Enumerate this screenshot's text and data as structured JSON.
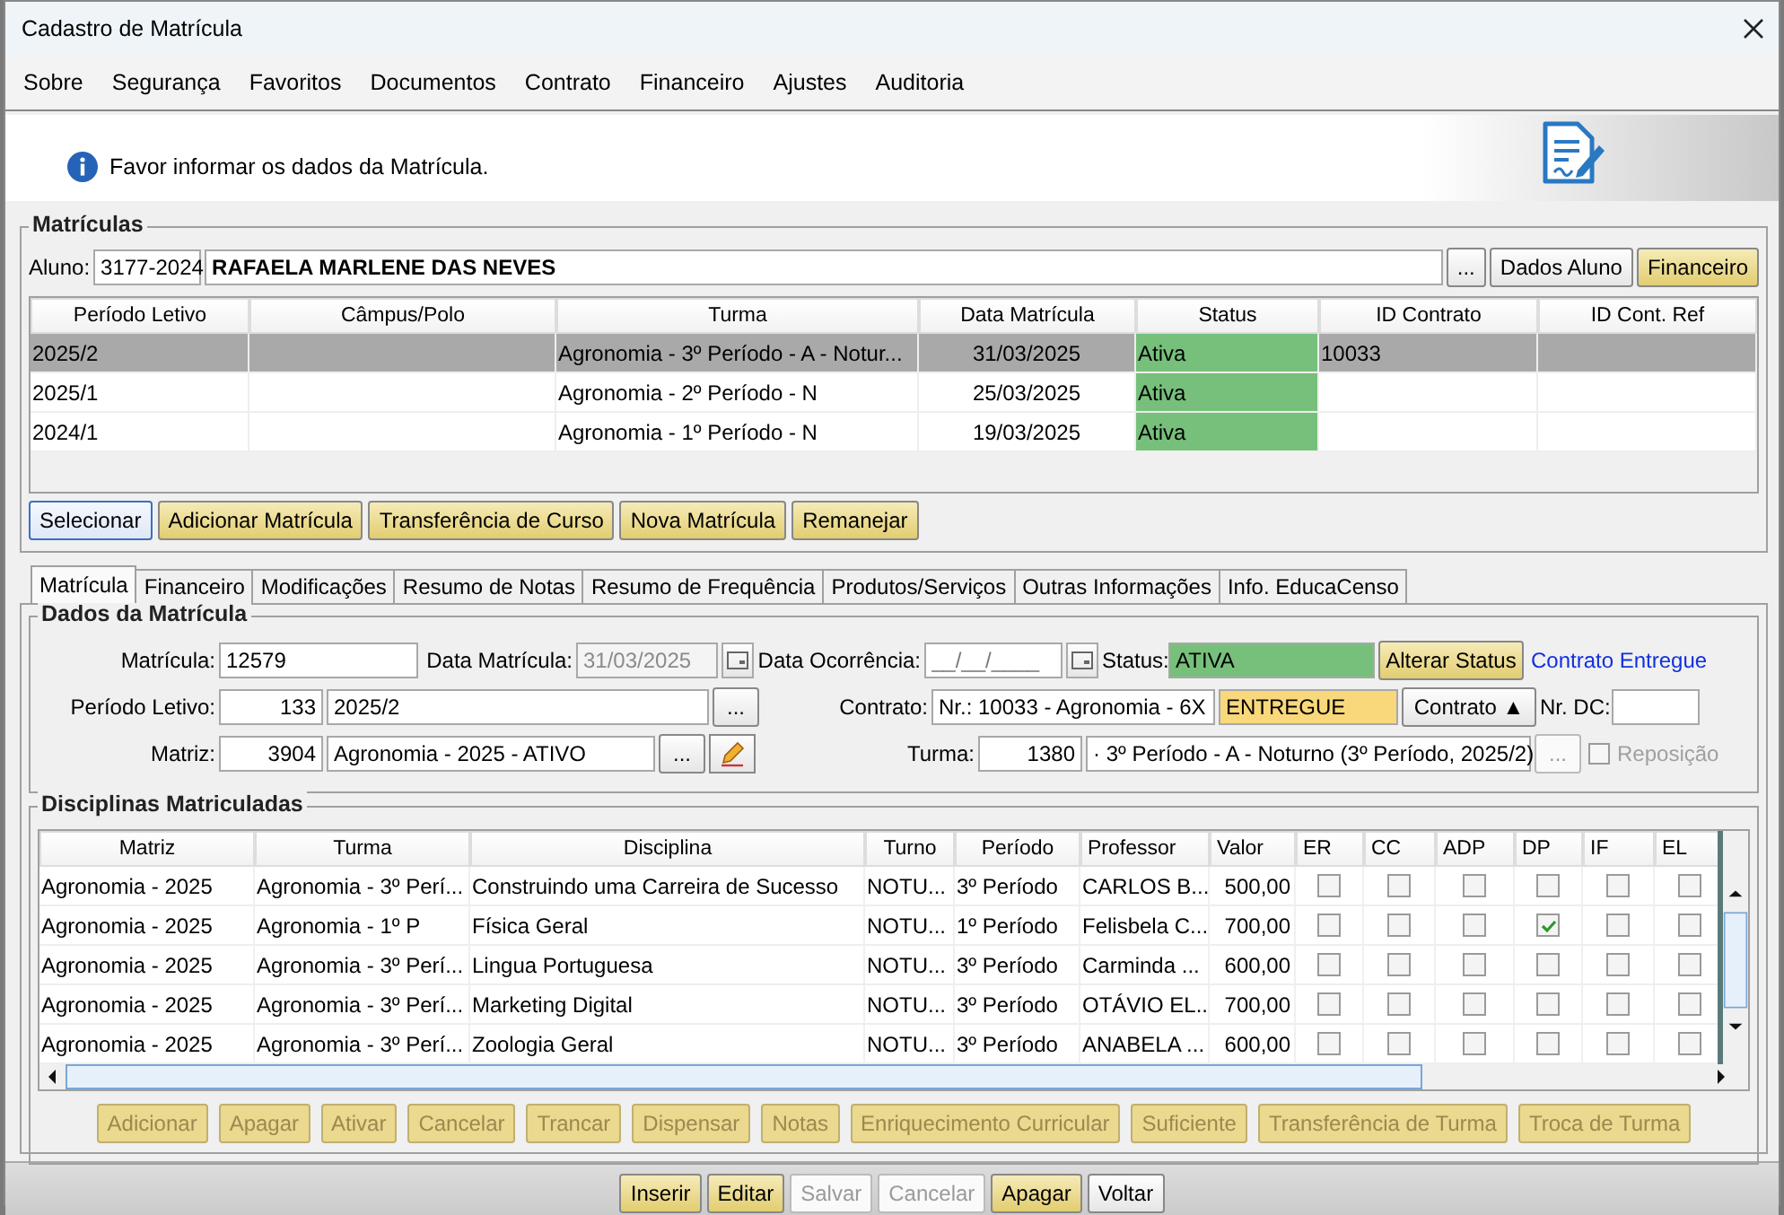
{
  "window": {
    "title": "Cadastro de Matrícula"
  },
  "menu": [
    "Sobre",
    "Segurança",
    "Favoritos",
    "Documentos",
    "Contrato",
    "Financeiro",
    "Ajustes",
    "Auditoria"
  ],
  "banner": {
    "message": "Favor informar os dados da Matrícula."
  },
  "matriculas": {
    "title": "Matrículas",
    "aluno": {
      "label": "Aluno:",
      "code": "3177-2024",
      "name": "RAFAELA MARLENE DAS NEVES"
    },
    "aluno_buttons": [
      {
        "label": "...",
        "kind": "plain"
      },
      {
        "label": "Dados Aluno",
        "kind": "plain"
      },
      {
        "label": "Financeiro",
        "kind": "yellow"
      }
    ],
    "columns": [
      {
        "label": "Período Letivo",
        "kind": "text"
      },
      {
        "label": "Câmpus/Polo",
        "kind": "text"
      },
      {
        "label": "Turma",
        "kind": "text"
      },
      {
        "label": "Data Matrícula",
        "kind": "number"
      },
      {
        "label": "Status",
        "kind": "status"
      },
      {
        "label": "ID Contrato",
        "kind": "text"
      },
      {
        "label": "ID Cont. Ref",
        "kind": "text"
      }
    ],
    "rows": [
      {
        "selected": true,
        "cells": [
          "2025/2",
          "",
          "Agronomia - 3º Período - A - Notur...",
          "31/03/2025",
          "Ativa",
          "10033",
          ""
        ]
      },
      {
        "selected": false,
        "cells": [
          "2025/1",
          "",
          "Agronomia - 2º Período - N",
          "25/03/2025",
          "Ativa",
          "",
          ""
        ]
      },
      {
        "selected": false,
        "cells": [
          "2024/1",
          "",
          "Agronomia - 1º Período - N",
          "19/03/2025",
          "Ativa",
          "",
          ""
        ]
      }
    ],
    "actions": [
      {
        "label": "Selecionar",
        "kind": "plain"
      },
      {
        "label": "Adicionar Matrícula",
        "kind": "yellow"
      },
      {
        "label": "Transferência de Curso",
        "kind": "yellow"
      },
      {
        "label": "Nova Matrícula",
        "kind": "yellow"
      },
      {
        "label": "Remanejar",
        "kind": "yellow"
      }
    ]
  },
  "tabs": [
    {
      "label": "Matrícula",
      "selected": true
    },
    {
      "label": "Financeiro",
      "selected": false
    },
    {
      "label": "Modificações",
      "selected": false
    },
    {
      "label": "Resumo de Notas",
      "selected": false
    },
    {
      "label": "Resumo de Frequência",
      "selected": false
    },
    {
      "label": "Produtos/Serviços",
      "selected": false
    },
    {
      "label": "Outras Informações",
      "selected": false
    },
    {
      "label": "Info. EducaCenso",
      "selected": false
    }
  ],
  "dados": {
    "title": "Dados da Matrícula",
    "matricula": {
      "label": "Matrícula:",
      "value": "12579"
    },
    "data_matricula": {
      "label": "Data Matrícula:",
      "value": "31/03/2025",
      "disabled": true
    },
    "data_ocorrencia": {
      "label": "Data Ocorrência:",
      "placeholder": "__/__/____"
    },
    "status": {
      "label": "Status:",
      "value": "ATIVA",
      "button": "Alterar Status",
      "link": "Contrato Entregue"
    },
    "periodo": {
      "label": "Período Letivo:",
      "code": "133",
      "value": "2025/2",
      "button": "..."
    },
    "contrato": {
      "label": "Contrato:",
      "value": "Nr.: 10033 - Agronomia - 6X",
      "state": "ENTREGUE",
      "button": "Contrato",
      "button_icon": "▲"
    },
    "nr_dc": {
      "label": "Nr. DC:"
    },
    "matriz": {
      "label": "Matriz:",
      "code": "3904",
      "value": "Agronomia - 2025 - ATIVO",
      "button": "..."
    },
    "turma": {
      "label": "Turma:",
      "code": "1380",
      "value": "· 3º Período - A - Noturno (3º Período, 2025/2)",
      "button": "...",
      "button_disabled": true
    },
    "reposicao": {
      "label": "Reposição",
      "checked": false,
      "disabled": true
    }
  },
  "disciplinas": {
    "title": "Disciplinas Matriculadas",
    "columns": [
      {
        "label": "Matriz",
        "kind": "text"
      },
      {
        "label": "Turma",
        "kind": "text"
      },
      {
        "label": "Disciplina",
        "kind": "text"
      },
      {
        "label": "Turno",
        "kind": "text"
      },
      {
        "label": "Período",
        "kind": "text"
      },
      {
        "label": "Professor",
        "kind": "text"
      },
      {
        "label": "Valor",
        "kind": "number"
      },
      {
        "label": "ER",
        "kind": "check"
      },
      {
        "label": "CC",
        "kind": "check"
      },
      {
        "label": "ADP",
        "kind": "check"
      },
      {
        "label": "DP",
        "kind": "check"
      },
      {
        "label": "IF",
        "kind": "check"
      },
      {
        "label": "EL",
        "kind": "check"
      }
    ],
    "rows": [
      {
        "cells": [
          "Agronomia - 2025",
          "Agronomia - 3º Perí...",
          "Construindo uma Carreira de Sucesso",
          "NOTU...",
          "3º Período",
          "CARLOS B...",
          "500,00"
        ],
        "checks": [
          {
            "checked": false
          },
          {
            "checked": false
          },
          {
            "checked": false
          },
          {
            "checked": false
          },
          {
            "checked": false
          },
          {
            "checked": false
          }
        ]
      },
      {
        "cells": [
          "Agronomia - 2025",
          "Agronomia - 1º P",
          "Física Geral",
          "NOTU...",
          "1º Período",
          "Felisbela C...",
          "700,00"
        ],
        "checks": [
          {
            "checked": false
          },
          {
            "checked": false
          },
          {
            "checked": false
          },
          {
            "checked": true
          },
          {
            "checked": false
          },
          {
            "checked": false
          }
        ]
      },
      {
        "cells": [
          "Agronomia - 2025",
          "Agronomia - 3º Perí...",
          "Lingua Portuguesa",
          "NOTU...",
          "3º Período",
          "Carminda ...",
          "600,00"
        ],
        "checks": [
          {
            "checked": false
          },
          {
            "checked": false
          },
          {
            "checked": false
          },
          {
            "checked": false
          },
          {
            "checked": false
          },
          {
            "checked": false
          }
        ]
      },
      {
        "cells": [
          "Agronomia - 2025",
          "Agronomia - 3º Perí...",
          "Marketing Digital",
          "NOTU...",
          "3º Período",
          "OTÁVIO EL...",
          "700,00"
        ],
        "checks": [
          {
            "checked": false
          },
          {
            "checked": false
          },
          {
            "checked": false
          },
          {
            "checked": false
          },
          {
            "checked": false
          },
          {
            "checked": false
          }
        ]
      },
      {
        "cells": [
          "Agronomia - 2025",
          "Agronomia - 3º Perí...",
          "Zoologia Geral",
          "NOTU...",
          "3º Período",
          "ANABELA ...",
          "600,00"
        ],
        "checks": [
          {
            "checked": false
          },
          {
            "checked": false
          },
          {
            "checked": false
          },
          {
            "checked": false
          },
          {
            "checked": false
          },
          {
            "checked": false
          }
        ]
      }
    ],
    "actions": [
      {
        "label": "Adicionar",
        "disabled": true
      },
      {
        "label": "Apagar",
        "disabled": true
      },
      {
        "label": "Ativar",
        "disabled": true
      },
      {
        "label": "Cancelar",
        "disabled": true
      },
      {
        "label": "Trancar",
        "disabled": true
      },
      {
        "label": "Dispensar",
        "disabled": true
      },
      {
        "label": "Notas",
        "disabled": true
      },
      {
        "label": "Enriquecimento Curricular",
        "disabled": true
      },
      {
        "label": "Suficiente",
        "disabled": true
      },
      {
        "label": "Transferência de Turma",
        "disabled": true
      },
      {
        "label": "Troca de Turma",
        "disabled": true
      }
    ]
  },
  "footer_buttons": [
    {
      "label": "Inserir",
      "kind": "yellow",
      "disabled": false
    },
    {
      "label": "Editar",
      "kind": "yellow",
      "disabled": false
    },
    {
      "label": "Salvar",
      "kind": "plain",
      "disabled": true
    },
    {
      "label": "Cancelar",
      "kind": "plain",
      "disabled": true
    },
    {
      "label": "Apagar",
      "kind": "yellow",
      "disabled": false
    },
    {
      "label": "Voltar",
      "kind": "plain",
      "disabled": false
    }
  ]
}
